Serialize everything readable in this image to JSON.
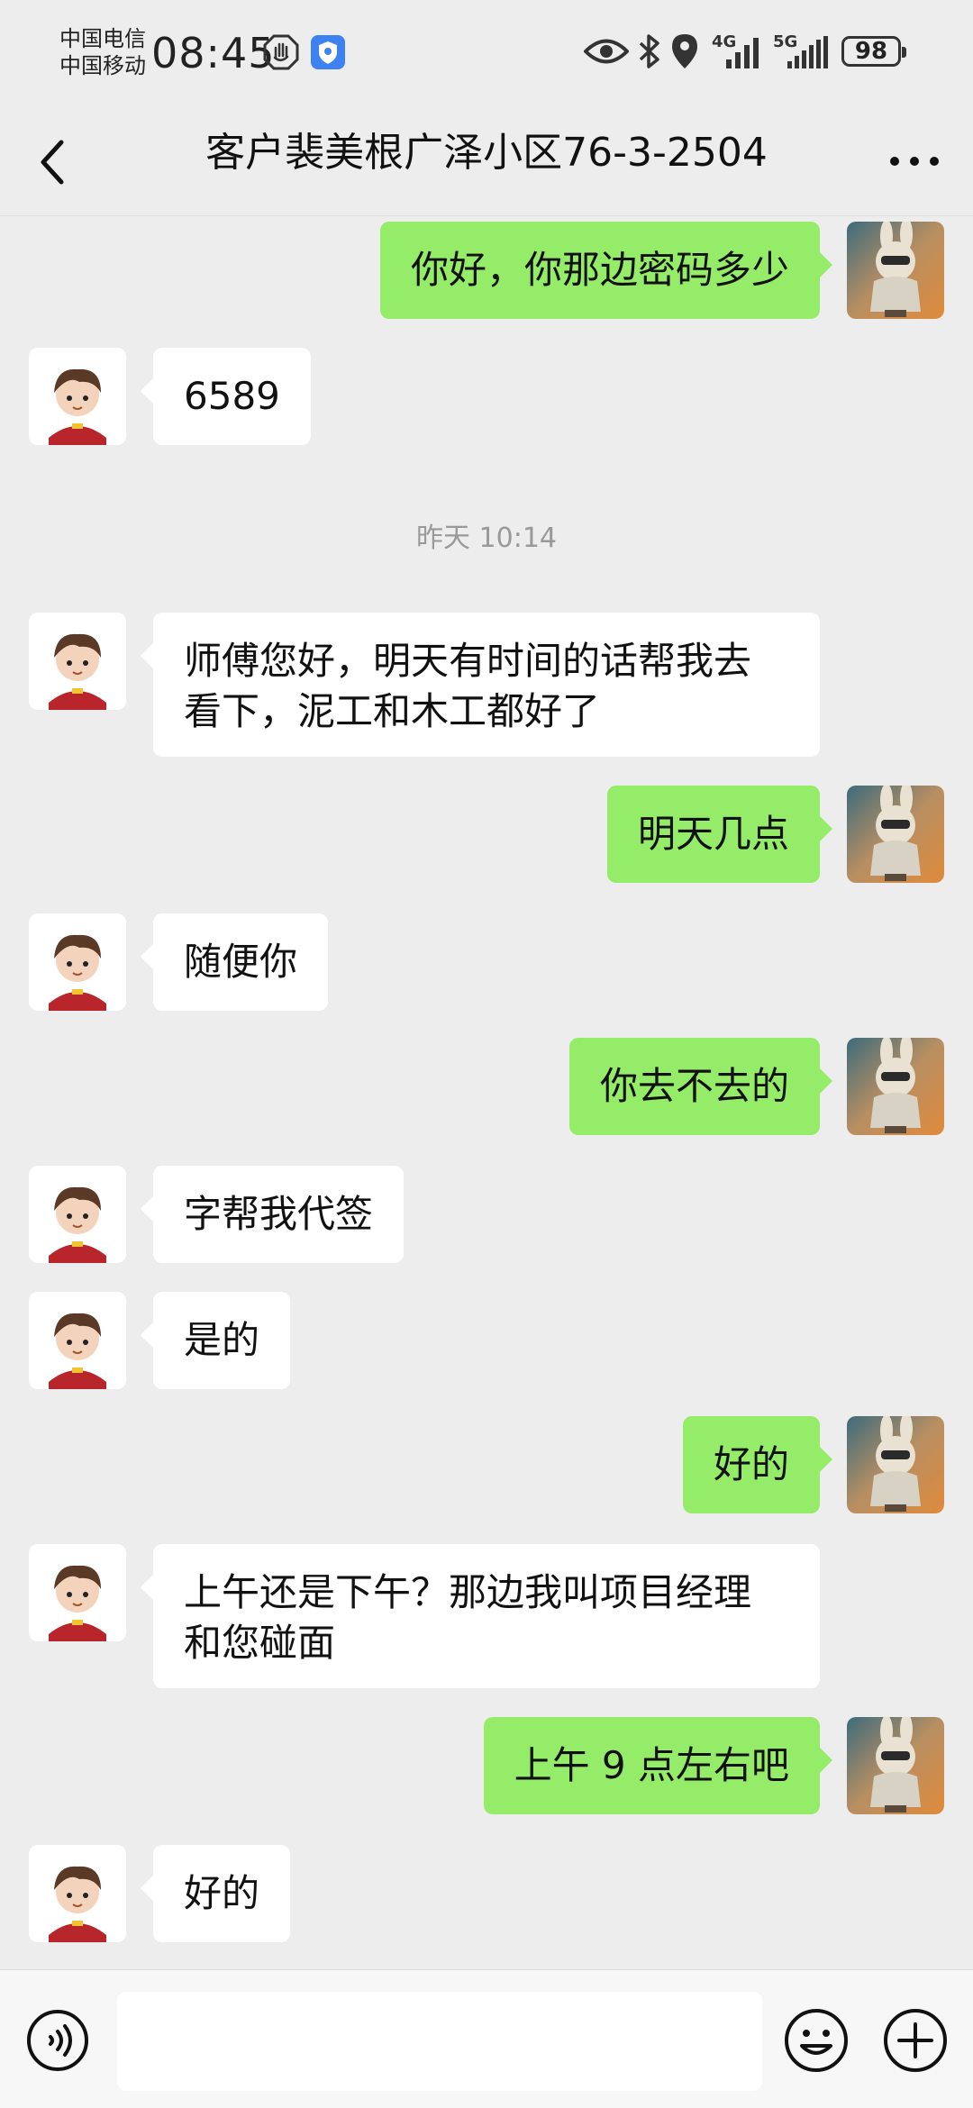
{
  "status_bar": {
    "carrier_1": "中国电信",
    "carrier_2": "中国移动",
    "time": "08:45",
    "net_4g": "4G",
    "net_5g": "5G",
    "battery": "98"
  },
  "header": {
    "title": "客户裴美根广泽小区76-3-2504"
  },
  "timestamp": "昨天 10:14",
  "messages": [
    {
      "side": "right",
      "text": "你好，你那边密码多少"
    },
    {
      "side": "left",
      "text": "6589"
    },
    {
      "side": "left",
      "text": "师傅您好，明天有时间的话帮我去\n看下，泥工和木工都好了"
    },
    {
      "side": "right",
      "text": "明天几点"
    },
    {
      "side": "left",
      "text": "随便你"
    },
    {
      "side": "right",
      "text": "你去不去的"
    },
    {
      "side": "left",
      "text": "字帮我代签"
    },
    {
      "side": "left",
      "text": "是的"
    },
    {
      "side": "right",
      "text": "好的"
    },
    {
      "side": "left",
      "text": "上午还是下午？那边我叫项目经理\n和您碰面"
    },
    {
      "side": "right",
      "text": "上午 9 点左右吧"
    },
    {
      "side": "left",
      "text": "好的"
    }
  ],
  "input": {
    "placeholder": ""
  },
  "colors": {
    "sent_bubble": "#95ec69",
    "received_bubble": "#ffffff",
    "background": "#ededed"
  },
  "icons": {
    "status": [
      "hand-icon",
      "shield-icon",
      "eye-icon",
      "bluetooth-icon",
      "location-icon",
      "signal-icon"
    ],
    "nav": [
      "back-chevron-icon",
      "more-dots-icon"
    ],
    "input_bar": [
      "voice-icon",
      "emoji-icon",
      "plus-icon"
    ]
  }
}
